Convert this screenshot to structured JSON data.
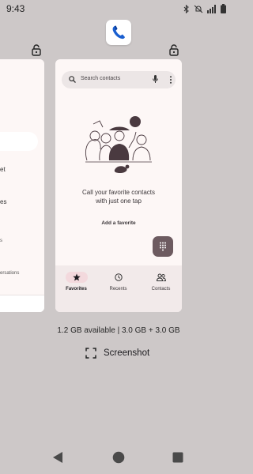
{
  "status_bar": {
    "time": "9:43",
    "icons": [
      "bluetooth-icon",
      "dnd-off-icon",
      "signal-icon",
      "battery-icon"
    ]
  },
  "recents": {
    "app_icon": "phone-app-icon",
    "left_card": {
      "items": [
        "et",
        "es",
        "s",
        "ersations"
      ]
    },
    "main_card": {
      "search_placeholder": "Search contacts",
      "empty_message": "Call your favorite contacts with just one tap",
      "add_favorite": "Add a favorite",
      "nav": [
        {
          "label": "Favorites",
          "icon": "star-icon",
          "active": true
        },
        {
          "label": "Recents",
          "icon": "clock-icon",
          "active": false
        },
        {
          "label": "Contacts",
          "icon": "people-icon",
          "active": false
        }
      ]
    },
    "memory_info": "1.2 GB available | 3.0 GB + 3.0 GB",
    "screenshot_label": "Screenshot"
  },
  "colors": {
    "background": "#cdc8c8",
    "card": "#fdf7f6",
    "fab": "#6d5b60",
    "active_pill": "#f3d9dd",
    "nav_bg": "#f2eaea"
  }
}
